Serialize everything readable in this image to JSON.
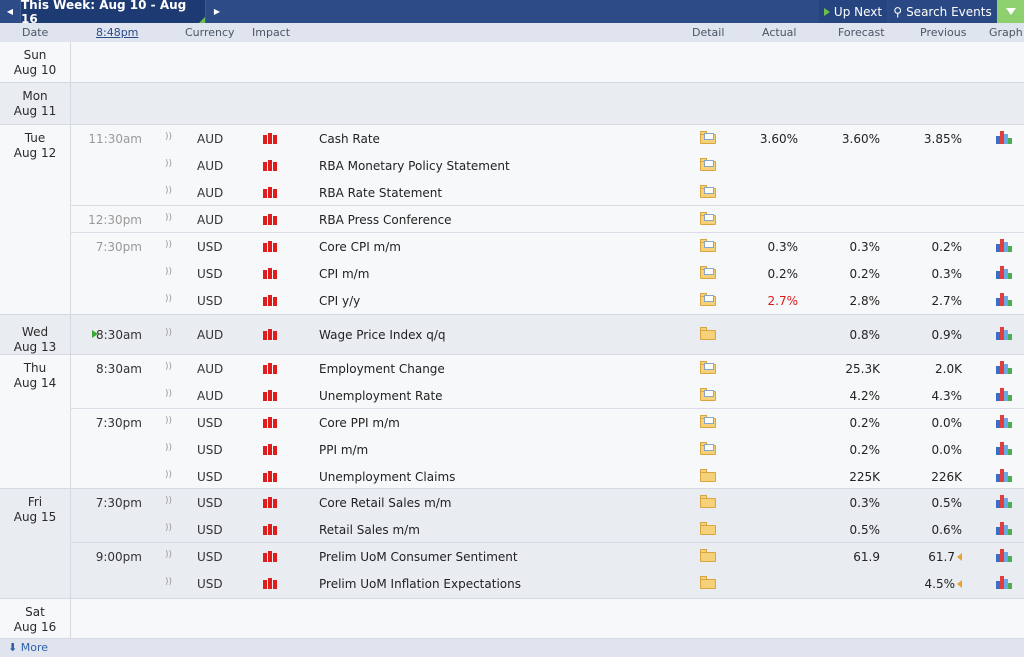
{
  "topbar": {
    "week_label": "This Week: Aug 10 - Aug 16",
    "up_next": "Up Next",
    "search": "Search Events"
  },
  "headers": {
    "date": "Date",
    "time": "8:48pm",
    "currency": "Currency",
    "impact": "Impact",
    "detail": "Detail",
    "actual": "Actual",
    "forecast": "Forecast",
    "previous": "Previous",
    "graph": "Graph"
  },
  "days": [
    {
      "dow": "Sun",
      "date": "Aug 10"
    },
    {
      "dow": "Mon",
      "date": "Aug 11"
    },
    {
      "dow": "Tue",
      "date": "Aug 12"
    },
    {
      "dow": "Wed",
      "date": "Aug 13"
    },
    {
      "dow": "Thu",
      "date": "Aug 14"
    },
    {
      "dow": "Fri",
      "date": "Aug 15"
    },
    {
      "dow": "Sat",
      "date": "Aug 16"
    }
  ],
  "events": [
    {
      "time": "11:30am",
      "currency": "AUD",
      "event": "Cash Rate",
      "actual": "3.60%",
      "forecast": "3.60%",
      "previous": "3.85%"
    },
    {
      "time": "",
      "currency": "AUD",
      "event": "RBA Monetary Policy Statement",
      "actual": "",
      "forecast": "",
      "previous": ""
    },
    {
      "time": "",
      "currency": "AUD",
      "event": "RBA Rate Statement",
      "actual": "",
      "forecast": "",
      "previous": ""
    },
    {
      "time": "12:30pm",
      "currency": "AUD",
      "event": "RBA Press Conference",
      "actual": "",
      "forecast": "",
      "previous": ""
    },
    {
      "time": "7:30pm",
      "currency": "USD",
      "event": "Core CPI m/m",
      "actual": "0.3%",
      "forecast": "0.3%",
      "previous": "0.2%"
    },
    {
      "time": "",
      "currency": "USD",
      "event": "CPI m/m",
      "actual": "0.2%",
      "forecast": "0.2%",
      "previous": "0.3%"
    },
    {
      "time": "",
      "currency": "USD",
      "event": "CPI y/y",
      "actual": "2.7%",
      "forecast": "2.8%",
      "previous": "2.7%"
    },
    {
      "time": "8:30am",
      "currency": "AUD",
      "event": "Wage Price Index q/q",
      "actual": "",
      "forecast": "0.8%",
      "previous": "0.9%"
    },
    {
      "time": "8:30am",
      "currency": "AUD",
      "event": "Employment Change",
      "actual": "",
      "forecast": "25.3K",
      "previous": "2.0K"
    },
    {
      "time": "",
      "currency": "AUD",
      "event": "Unemployment Rate",
      "actual": "",
      "forecast": "4.2%",
      "previous": "4.3%"
    },
    {
      "time": "7:30pm",
      "currency": "USD",
      "event": "Core PPI m/m",
      "actual": "",
      "forecast": "0.2%",
      "previous": "0.0%"
    },
    {
      "time": "",
      "currency": "USD",
      "event": "PPI m/m",
      "actual": "",
      "forecast": "0.2%",
      "previous": "0.0%"
    },
    {
      "time": "",
      "currency": "USD",
      "event": "Unemployment Claims",
      "actual": "",
      "forecast": "225K",
      "previous": "226K"
    },
    {
      "time": "7:30pm",
      "currency": "USD",
      "event": "Core Retail Sales m/m",
      "actual": "",
      "forecast": "0.3%",
      "previous": "0.5%"
    },
    {
      "time": "",
      "currency": "USD",
      "event": "Retail Sales m/m",
      "actual": "",
      "forecast": "0.5%",
      "previous": "0.6%"
    },
    {
      "time": "9:00pm",
      "currency": "USD",
      "event": "Prelim UoM Consumer Sentiment",
      "actual": "",
      "forecast": "61.9",
      "previous": "61.7"
    },
    {
      "time": "",
      "currency": "USD",
      "event": "Prelim UoM Inflation Expectations",
      "actual": "",
      "forecast": "",
      "previous": "4.5%"
    }
  ],
  "footer": {
    "more": "More"
  },
  "colors": {
    "topbar": "#2d4b86",
    "impact_high": "#e01d1d",
    "actual_worse": "#d61d1d",
    "filter_active": "#8fd06e"
  }
}
